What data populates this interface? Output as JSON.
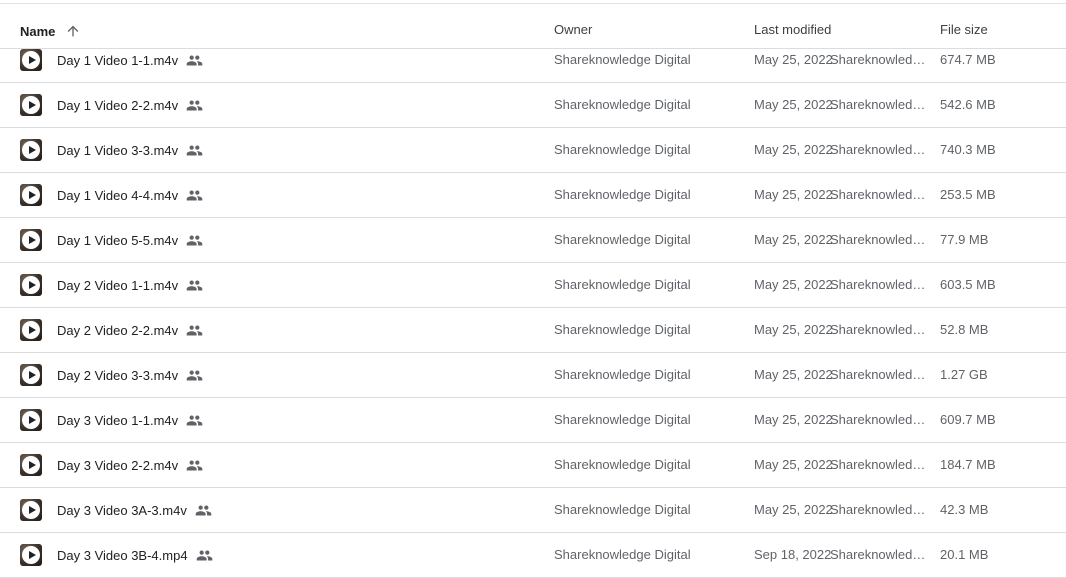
{
  "header": {
    "name_label": "Name",
    "owner_label": "Owner",
    "modified_label": "Last modified",
    "size_label": "File size",
    "sort_icon": "arrow-up-icon"
  },
  "rows": [
    {
      "name": "Day 1 Video 1-1.m4v",
      "owner": "Shareknowledge Digital",
      "date": "May 25, 2022",
      "by": "Shareknowledge Digital",
      "size": "674.7 MB"
    },
    {
      "name": "Day 1 Video 2-2.m4v",
      "owner": "Shareknowledge Digital",
      "date": "May 25, 2022",
      "by": "Shareknowledge Digital",
      "size": "542.6 MB"
    },
    {
      "name": "Day 1 Video 3-3.m4v",
      "owner": "Shareknowledge Digital",
      "date": "May 25, 2022",
      "by": "Shareknowledge Digital",
      "size": "740.3 MB"
    },
    {
      "name": "Day 1 Video 4-4.m4v",
      "owner": "Shareknowledge Digital",
      "date": "May 25, 2022",
      "by": "Shareknowledge Digital",
      "size": "253.5 MB"
    },
    {
      "name": "Day 1 Video 5-5.m4v",
      "owner": "Shareknowledge Digital",
      "date": "May 25, 2022",
      "by": "Shareknowledge Digital",
      "size": "77.9 MB"
    },
    {
      "name": "Day 2 Video 1-1.m4v",
      "owner": "Shareknowledge Digital",
      "date": "May 25, 2022",
      "by": "Shareknowledge Digital",
      "size": "603.5 MB"
    },
    {
      "name": "Day 2 Video 2-2.m4v",
      "owner": "Shareknowledge Digital",
      "date": "May 25, 2022",
      "by": "Shareknowledge Digital",
      "size": "52.8 MB"
    },
    {
      "name": "Day 2 Video 3-3.m4v",
      "owner": "Shareknowledge Digital",
      "date": "May 25, 2022",
      "by": "Shareknowledge Digital",
      "size": "1.27 GB"
    },
    {
      "name": "Day 3 Video 1-1.m4v",
      "owner": "Shareknowledge Digital",
      "date": "May 25, 2022",
      "by": "Shareknowledge Digital",
      "size": "609.7 MB"
    },
    {
      "name": "Day 3 Video 2-2.m4v",
      "owner": "Shareknowledge Digital",
      "date": "May 25, 2022",
      "by": "Shareknowledge Digital",
      "size": "184.7 MB"
    },
    {
      "name": "Day 3 Video 3A-3.m4v",
      "owner": "Shareknowledge Digital",
      "date": "May 25, 2022",
      "by": "Shareknowledge Digital",
      "size": "42.3 MB"
    },
    {
      "name": "Day 3 Video 3B-4.mp4",
      "owner": "Shareknowledge Digital",
      "date": "Sep 18, 2022",
      "by": "Shareknowledge Digital",
      "size": "20.1 MB"
    }
  ],
  "row_icons": {
    "thumbnail": "video-play-icon",
    "shared": "shared-people-icon"
  }
}
